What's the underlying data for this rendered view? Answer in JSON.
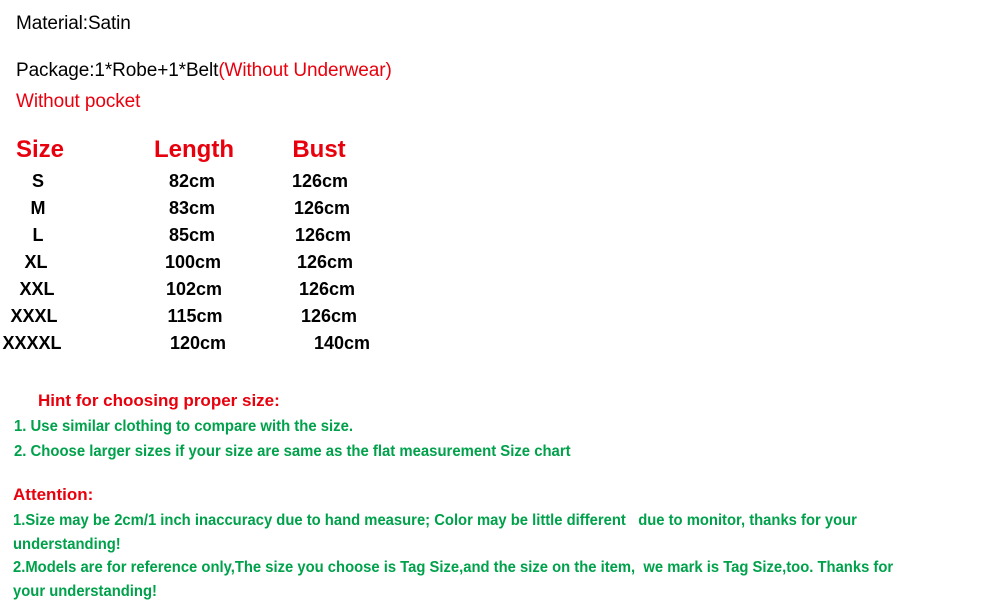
{
  "colors": {
    "red": "#e8000d",
    "green": "#00a14b",
    "black": "#000000",
    "background": "#ffffff"
  },
  "intro": {
    "material": "Material:Satin",
    "package_black": "Package:1*Robe+1*Belt",
    "package_red": "(Without Underwear)",
    "pocket": "Without pocket"
  },
  "size_chart": {
    "headers": [
      "Size",
      "Length",
      "Bust"
    ],
    "rows": [
      {
        "size": "S",
        "length": "82cm",
        "bust": "126cm"
      },
      {
        "size": "M",
        "length": "83cm",
        "bust": "126cm"
      },
      {
        "size": "L",
        "length": "85cm",
        "bust": "126cm"
      },
      {
        "size": "XL",
        "length": "100cm",
        "bust": "126cm"
      },
      {
        "size": "XXL",
        "length": "102cm",
        "bust": "126cm"
      },
      {
        "size": "XXXL",
        "length": "115cm",
        "bust": "126cm"
      },
      {
        "size": "XXXXL",
        "length": "120cm",
        "bust": "140cm"
      }
    ]
  },
  "hint": {
    "title": "Hint for choosing proper size:",
    "items": [
      "1. Use similar clothing to compare with the size.",
      "2. Choose larger sizes if your size are same as the flat measurement Size chart"
    ]
  },
  "attention": {
    "title": "Attention:",
    "paragraphs": [
      "1.Size may be 2cm/1 inch inaccuracy due to hand measure; Color may be little different   due to monitor, thanks for your understanding!",
      "2.Models are for reference only,The size you choose is Tag Size,and the size on the item,  we mark is Tag Size,too. Thanks for your understanding!"
    ]
  }
}
